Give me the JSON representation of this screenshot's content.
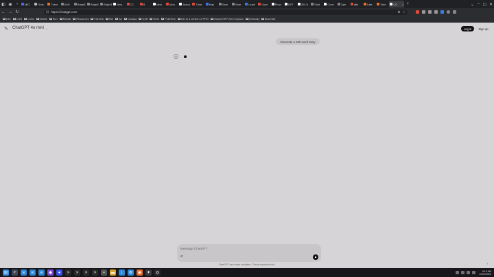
{
  "browser": {
    "tabs": [
      {
        "title": "MiG",
        "color": "#4f6ee8"
      },
      {
        "title": "Grok",
        "color": "#bbbbbb"
      },
      {
        "title": "Trans",
        "color": "#e8742a"
      },
      {
        "title": "N2H",
        "color": "#888888"
      },
      {
        "title": "BrightD",
        "color": "#888888"
      },
      {
        "title": "BrightD",
        "color": "#888888"
      },
      {
        "title": "BrightD",
        "color": "#888888"
      },
      {
        "title": "New",
        "color": "#ffffff"
      },
      {
        "title": "CC",
        "color": "#e04b3c"
      },
      {
        "title": "B",
        "color": "#e04b3c"
      },
      {
        "title": "New",
        "color": "#ffffff"
      },
      {
        "title": "Mon",
        "color": "#e04b3c"
      },
      {
        "title": "Jason",
        "color": "#ffffff"
      },
      {
        "title": "Time",
        "color": "#e04b3c"
      },
      {
        "title": "Map",
        "color": "#3a7ee6"
      },
      {
        "title": "Sam",
        "color": "#888888"
      },
      {
        "title": "Sam",
        "color": "#888888"
      },
      {
        "title": "Learn",
        "color": "#3a7ee6"
      },
      {
        "title": "Oper",
        "color": "#e04b3c"
      },
      {
        "title": "Phon",
        "color": "#ffffff"
      },
      {
        "title": "GPT",
        "color": "#ffffff"
      },
      {
        "title": "ZECh",
        "color": "#ffffff"
      },
      {
        "title": "Sold",
        "color": "#888888"
      },
      {
        "title": "Cons",
        "color": "#ffffff"
      },
      {
        "title": "Ope",
        "color": "#888888"
      },
      {
        "title": "afte",
        "color": "#e04b3c"
      },
      {
        "title": "Late",
        "color": "#e8742a"
      },
      {
        "title": "Toke",
        "color": "#e8742a"
      },
      {
        "title": "CG",
        "color": "#ffffff",
        "active": true
      }
    ],
    "url": "https://chatgpt.com",
    "bookmarks": [
      "Dev",
      "COR",
      "LLMs",
      "Mobile",
      "Run",
      "Mentat",
      "Resources",
      "Interesti",
      "ISE",
      "Art",
      "Canada",
      "GSB",
      "Work",
      "PokéRub",
      "Get to a version of PRO",
      "Oracle ERP ZDX Explora",
      "[Outlook]",
      "Bloomfiel"
    ]
  },
  "app": {
    "model_name": "ChatGPT 4o mini",
    "login_label": "Log in",
    "signup_label": "Sign up",
    "user_message": "Generate a 100-word story",
    "composer_placeholder": "Message ChatGPT",
    "disclaimer": "ChatGPT can make mistakes. Check important info.",
    "help_label": "?"
  },
  "taskbar": {
    "icons": [
      {
        "name": "start-icon",
        "glyph": "⊞",
        "color": "#3a8ee6"
      },
      {
        "name": "search-icon",
        "glyph": "⌕",
        "color": "#444a55"
      },
      {
        "name": "edge-icon",
        "glyph": "e",
        "color": "#2d86d6"
      },
      {
        "name": "edge-icon",
        "glyph": "e",
        "color": "#2d86d6"
      },
      {
        "name": "edge-icon",
        "glyph": "e",
        "color": "#2d86d6"
      },
      {
        "name": "app-icon",
        "glyph": "◆",
        "color": "#7a4fd6"
      },
      {
        "name": "app-icon",
        "glyph": "●",
        "color": "#3a4ee6"
      },
      {
        "name": "terminal-icon",
        "glyph": ">",
        "color": "#2b2b2b"
      },
      {
        "name": "terminal-icon",
        "glyph": ">",
        "color": "#2b2b2b"
      },
      {
        "name": "terminal-icon",
        "glyph": ">",
        "color": "#2b2b2b"
      },
      {
        "name": "terminal-icon",
        "glyph": ">",
        "color": "#2b2b2b"
      },
      {
        "name": "file-icon",
        "glyph": "▪",
        "color": "#555555"
      },
      {
        "name": "folder-icon",
        "glyph": "▬",
        "color": "#d8a530"
      },
      {
        "name": "vscode-icon",
        "glyph": "⟩",
        "color": "#2d86d6"
      },
      {
        "name": "settings-icon",
        "glyph": "⚙",
        "color": "#2d86d6"
      },
      {
        "name": "app-icon",
        "glyph": "◉",
        "color": "#e86a2a"
      },
      {
        "name": "chatgpt-icon",
        "glyph": "✦",
        "color": "#ffffff"
      },
      {
        "name": "github-icon",
        "glyph": "◎",
        "color": "#2b2b2b"
      }
    ],
    "time": "9:15 AM",
    "date": "11/22/2024"
  }
}
